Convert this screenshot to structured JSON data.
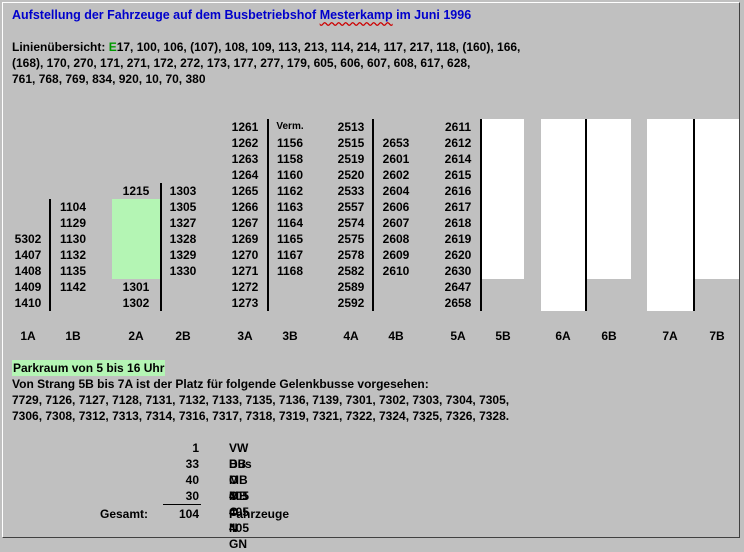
{
  "title": {
    "pre": "Aufstellung der Fahrzeuge auf dem Busbetriebshof ",
    "sq": "Mesterkamp",
    "post": " im Juni 1996"
  },
  "lines": {
    "label": "Linienübersicht: ",
    "e": "E",
    "l1": "17, 100, 106, (107), 108, 109, 113, 213, 114, 214, 117, 217, 118, (160), 166,",
    "l2": "(168), 170, 270, 171, 271, 172, 272, 173, 177, 277, 179, 605, 606, 607, 608, 617, 628,",
    "l3": "761, 768, 769, 834, 920, 10, 70, 380"
  },
  "cols": {
    "c1a": [
      "5302",
      "1407",
      "1408",
      "1409",
      "1410"
    ],
    "c1b": [
      "1104",
      "1129",
      "1130",
      "1132",
      "1135",
      "1142"
    ],
    "c2a": [
      "1215",
      "",
      "",
      "",
      "",
      "",
      "1301",
      "1302"
    ],
    "c2b": [
      "1303",
      "1305",
      "1327",
      "1328",
      "1329",
      "1330"
    ],
    "c3a": [
      "1261",
      "1262",
      "1263",
      "1264",
      "1265",
      "1266",
      "1267",
      "1269",
      "1270",
      "1271",
      "1272",
      "1273"
    ],
    "c3b": [
      "Verm.",
      "1156",
      "1158",
      "1160",
      "1162",
      "1163",
      "1164",
      "1165",
      "1167",
      "1168"
    ],
    "c4a": [
      "2513",
      "2515",
      "2519",
      "2520",
      "2533",
      "2557",
      "2574",
      "2575",
      "2578",
      "2582",
      "2589",
      "2592"
    ],
    "c4b": [
      "2653",
      "2601",
      "2602",
      "2604",
      "2606",
      "2607",
      "2608",
      "2609",
      "2610"
    ],
    "c5a": [
      "2611",
      "2612",
      "2614",
      "2615",
      "2616",
      "2617",
      "2618",
      "2619",
      "2620",
      "2630",
      "2647",
      "2658"
    ]
  },
  "lanes": [
    "1A",
    "1B",
    "2A",
    "2B",
    "3A",
    "3B",
    "4A",
    "4B",
    "5A",
    "5B",
    "6A",
    "6B",
    "7A",
    "7B"
  ],
  "park": {
    "heading": "Parkraum von 5 bis 16 Uhr",
    "l1": "Von Strang 5B bis 7A ist der Platz für folgende Gelenkbusse vorgesehen:",
    "l2": "7729, 7126, 7127, 7128, 7131, 7132, 7133, 7135, 7136, 7139, 7301, 7302, 7303, 7304, 7305,",
    "l3": "7306, 7308, 7312, 7313, 7314, 7316, 7317, 7318, 7319, 7321, 7322, 7324, 7325, 7326, 7328."
  },
  "summary": {
    "rows": [
      {
        "n": "1",
        "t": "VW Bus"
      },
      {
        "n": "33",
        "t": "DB O 405"
      },
      {
        "n": "40",
        "t": "MB O 405 N"
      },
      {
        "n": "30",
        "t": "MB O 405 GN"
      }
    ],
    "total_label": "Gesamt:",
    "total_n": "104",
    "total_t": "Fahrzeuge"
  },
  "colors": {
    "title": "#0000cc",
    "green_e": "#009900",
    "green_fill": "#b4f5b4",
    "background": "#c0c0c0"
  }
}
